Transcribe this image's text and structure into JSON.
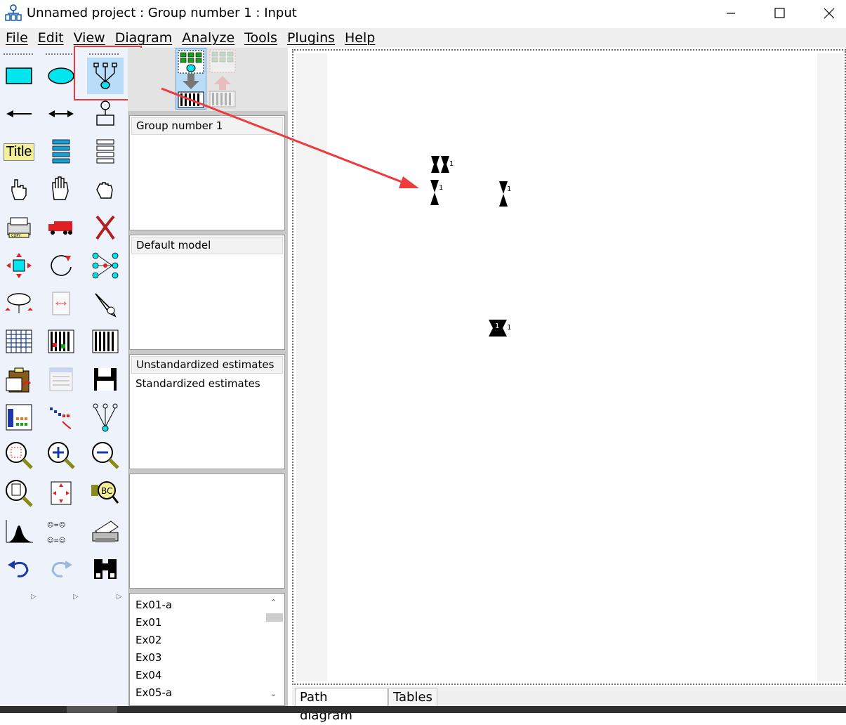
{
  "window": {
    "title": "Unnamed project : Group number 1 : Input"
  },
  "menubar": {
    "items": [
      "File",
      "Edit",
      "View",
      "Diagram",
      "Analyze",
      "Tools",
      "Plugins",
      "Help"
    ]
  },
  "panels": {
    "groups": [
      "Group number 1"
    ],
    "models": [
      "Default model"
    ],
    "estimates": [
      "Unstandardized estimates",
      "Standardized estimates"
    ],
    "files": [
      "Ex01-a",
      "Ex01",
      "Ex02",
      "Ex03",
      "Ex04",
      "Ex05-a"
    ]
  },
  "tools": {
    "title_tool_label": "Title"
  },
  "diagram": {
    "object_label": "1"
  },
  "tabs": {
    "path_diagram": "Path diagram",
    "tables": "Tables"
  },
  "colors": {
    "accent_red": "#ee3a3a",
    "toolbox_bg": "#eef3fb",
    "shape_cyan": "#00e5ee"
  }
}
